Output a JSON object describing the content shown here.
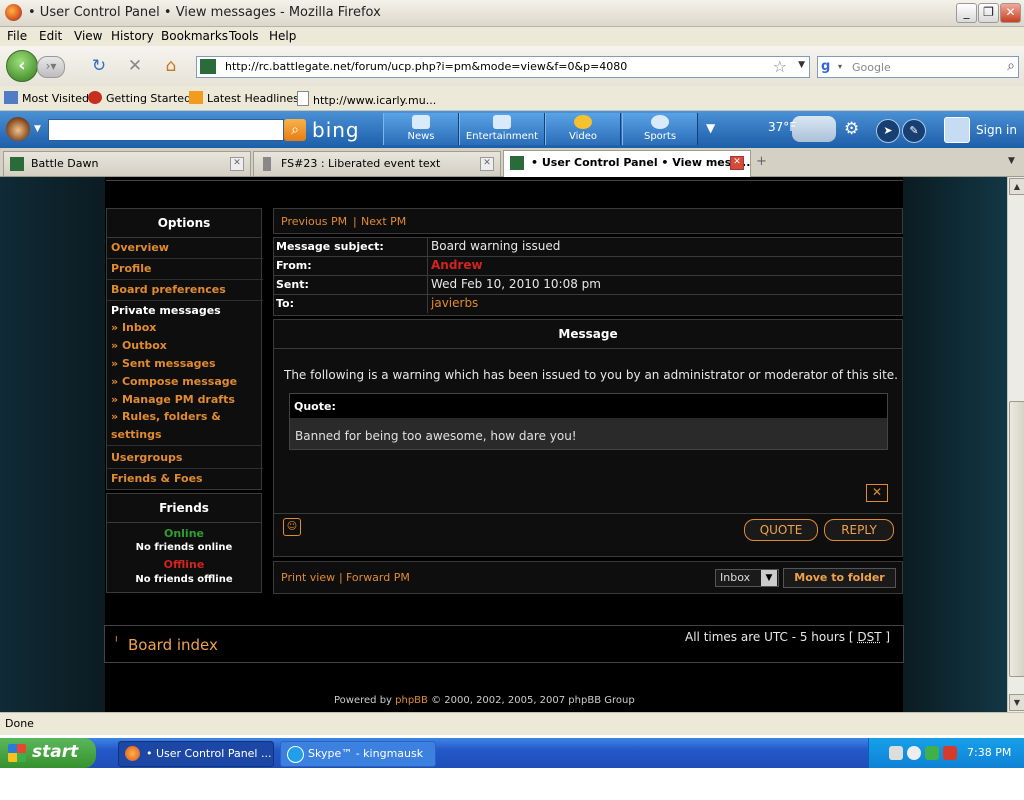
{
  "window": {
    "title": "• User Control Panel • View messages - Mozilla Firefox"
  },
  "menu": [
    "File",
    "Edit",
    "View",
    "History",
    "Bookmarks",
    "Tools",
    "Help"
  ],
  "nav": {
    "url": "http://rc.battlegate.net/forum/ucp.php?i=pm&mode=view&f=0&p=4080",
    "search_placeholder": "Google"
  },
  "bookmarks": [
    "Most Visited",
    "Getting Started",
    "Latest Headlines",
    "http://www.icarly.mu..."
  ],
  "bing": {
    "logo": "bing",
    "tabs": [
      "News",
      "Entertainment",
      "Video",
      "Sports"
    ],
    "temperature": "37°F",
    "signin": "Sign in"
  },
  "tabs": [
    {
      "label": "Battle Dawn"
    },
    {
      "label": "FS#23 : Liberated event text"
    },
    {
      "label": "• User Control Panel • View mess..."
    }
  ],
  "forum": {
    "options_title": "Options",
    "options": [
      "Overview",
      "Profile",
      "Board preferences"
    ],
    "pm_heading": "Private messages",
    "pm_links": [
      "Inbox",
      "Outbox",
      "Sent messages",
      "Compose message",
      "Manage PM drafts",
      "Rules, folders &",
      "settings"
    ],
    "options_bottom": [
      "Usergroups",
      "Friends & Foes"
    ],
    "friends_title": "Friends",
    "online_label": "Online",
    "online_text": "No friends online",
    "offline_label": "Offline",
    "offline_text": "No friends offline",
    "pm_nav": {
      "prev": "Previous PM",
      "sep": "|",
      "next": "Next PM"
    },
    "headers": {
      "subject_label": "Message subject:",
      "subject": "Board warning issued",
      "from_label": "From:",
      "from": "Andrew",
      "sent_label": "Sent:",
      "sent": "Wed Feb 10, 2010 10:08 pm",
      "to_label": "To:",
      "to": "javierbs"
    },
    "message_title": "Message",
    "message_body": "The following is a warning which has been issued to you by an administrator or moderator of this site.",
    "quote_label": "Quote:",
    "quote_text": "Banned for being too awesome, how dare you!",
    "quote_button": "QUOTE",
    "reply_button": "REPLY",
    "print_view": "Print view",
    "forward_pm": "Forward PM",
    "folder_select": "Inbox",
    "move_button": "Move to folder",
    "board_index": "Board index",
    "timezone": "All times are UTC - 5 hours [ ",
    "dst": "DST",
    "timezone_end": " ]",
    "powered_prefix": "Powered by ",
    "powered_link": "phpBB",
    "powered_suffix": " © 2000, 2002, 2005, 2007 phpBB Group"
  },
  "status": "Done",
  "taskbar": {
    "start": "start",
    "items": [
      "• User Control Panel ...",
      "Skype™ - kingmausk"
    ],
    "clock": "7:38 PM"
  },
  "colors": {
    "accent_orange": "#e08b2f",
    "from_red": "#d2231d",
    "online_green": "#2f9e2f",
    "offline_red": "#d2231d"
  }
}
